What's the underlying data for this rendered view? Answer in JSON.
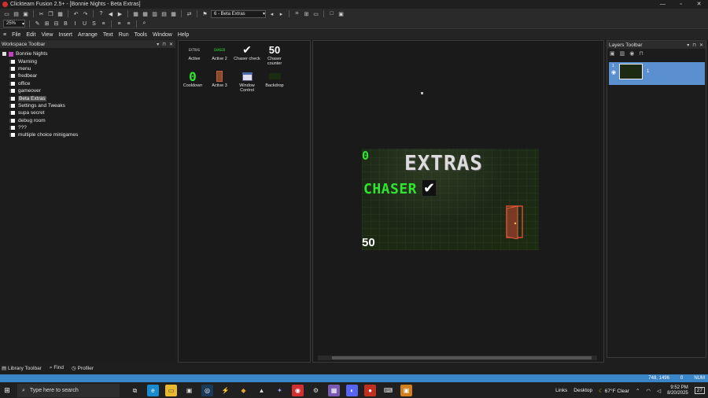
{
  "window": {
    "title": "Clickteam Fusion 2.5+ - [Bonnie Nights - Beta Extras]",
    "controls": [
      "—",
      "▫",
      "✕"
    ]
  },
  "toolbar": {
    "frame_select": "6 - Beta Extras",
    "zoom": "25%"
  },
  "menu": [
    "File",
    "Edit",
    "View",
    "Insert",
    "Arrange",
    "Text",
    "Run",
    "Tools",
    "Window",
    "Help"
  ],
  "workspace": {
    "title": "Workspace Toolbar",
    "root": "Bonnie Nights",
    "frames": [
      "Warning",
      "menu",
      "fredbear",
      "office",
      "gameover",
      "Beta Extras",
      "Settings and Tweaks",
      "supa secret",
      "debug room",
      "???",
      "multiple choice minigames"
    ],
    "selected_index": 5
  },
  "objects": [
    {
      "label": "Active",
      "thumb_text": "EXTRAS"
    },
    {
      "label": "Active 2",
      "thumb_text": "CHASER"
    },
    {
      "label": "Chaser check",
      "thumb_text": "✔"
    },
    {
      "label": "Chaser counter",
      "thumb_text": "50"
    },
    {
      "label": "Cooldown",
      "thumb_text": "0"
    },
    {
      "label": "Active 3",
      "thumb_text": ""
    },
    {
      "label": "Window Control",
      "thumb_text": ""
    },
    {
      "label": "Backdrop",
      "thumb_text": ""
    }
  ],
  "frame": {
    "counter_top": "0",
    "title": "EXTRAS",
    "chaser": "CHASER",
    "check": "✔",
    "counter_bottom": "50"
  },
  "layers": {
    "title": "Layers Toolbar",
    "items": [
      {
        "num": "1",
        "name": "1"
      }
    ]
  },
  "bottom_tabs": [
    "Library Toolbar",
    "Find",
    "Profiler"
  ],
  "status": {
    "coords": "748, 1496",
    "value": "0",
    "num": "NUM"
  },
  "taskbar": {
    "search": "Type here to search",
    "links": "Links",
    "desktop": "Desktop",
    "weather": "67°F Clear",
    "time": "9:52 PM",
    "date": "8/20/2025",
    "notif": "27"
  },
  "colors": {
    "accent": "#3a84c8",
    "chaser_green": "#2ee62e",
    "layer_selected": "#5a8fd0"
  }
}
